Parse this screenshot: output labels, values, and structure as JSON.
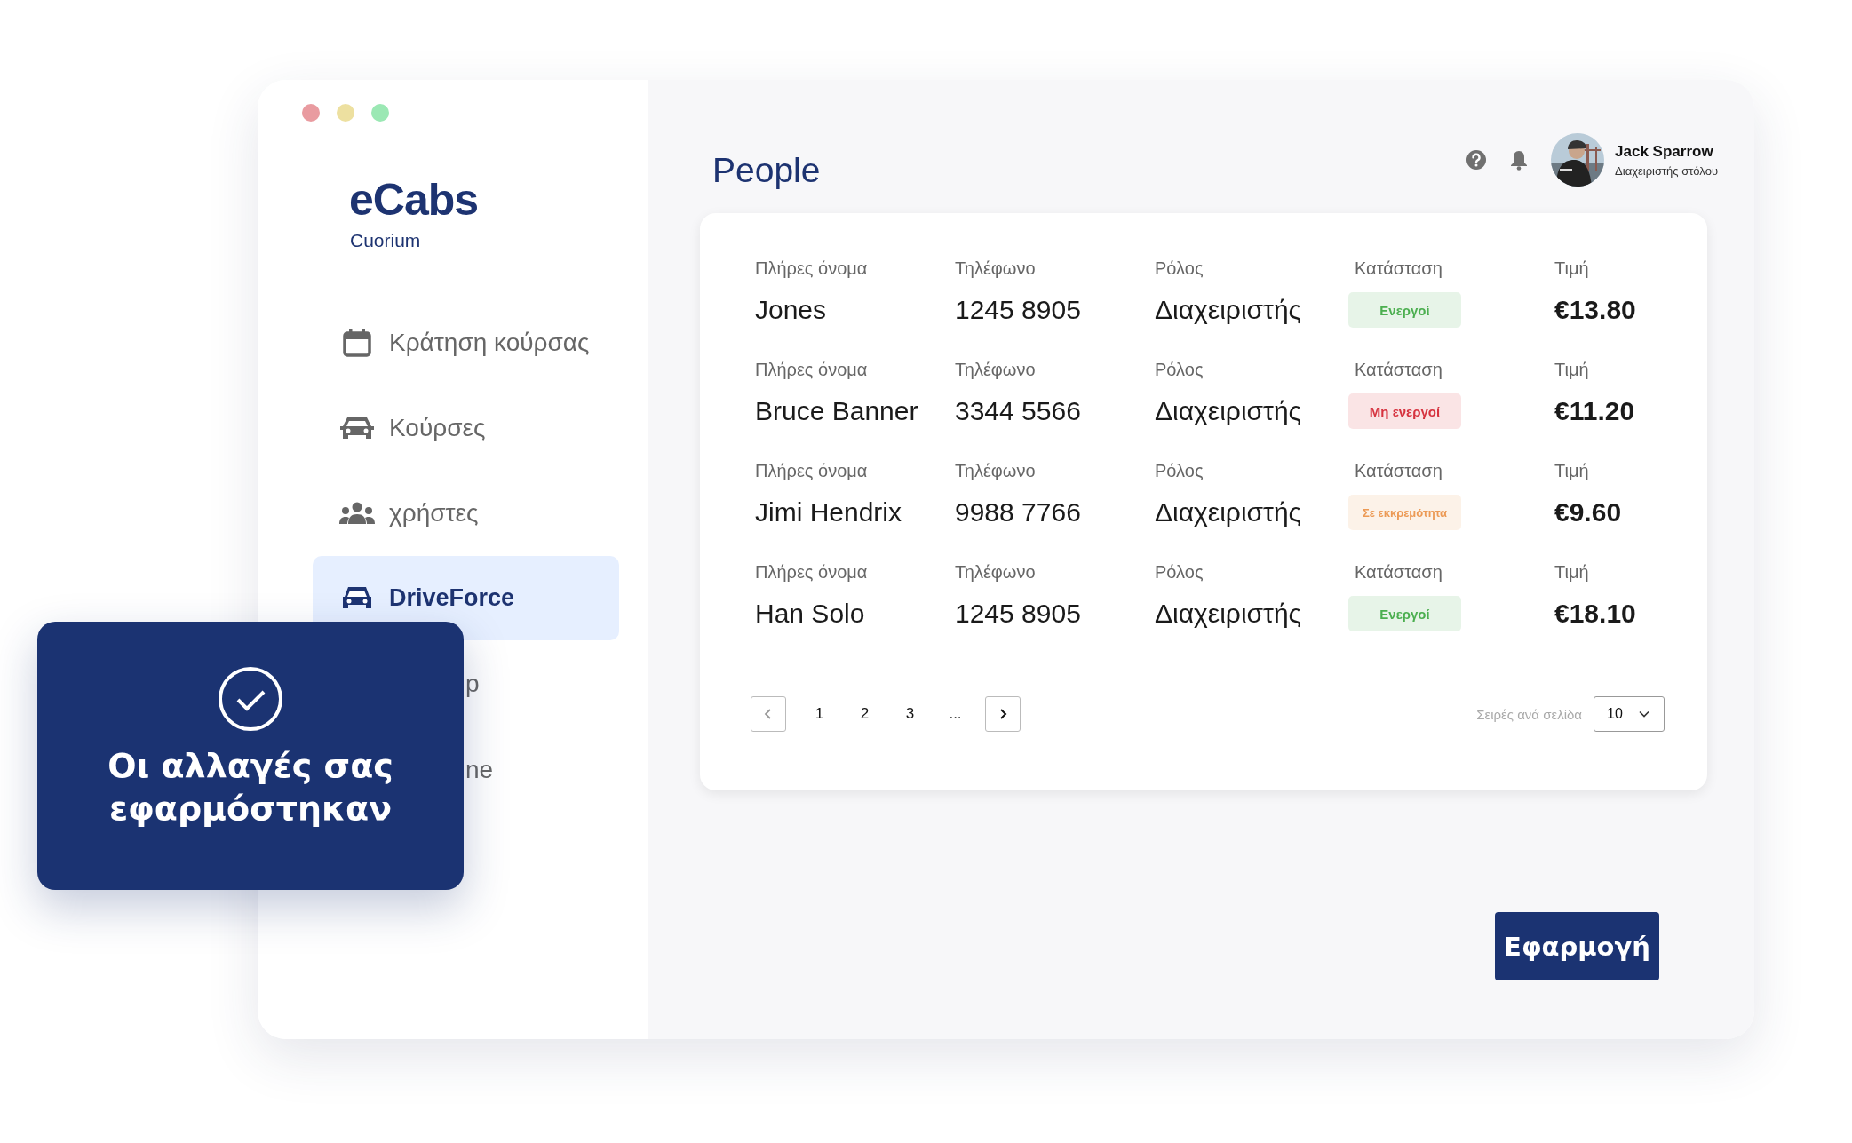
{
  "window": {
    "controls": [
      {
        "color": "#e99ba0"
      },
      {
        "color": "#ede0a0"
      },
      {
        "color": "#9be8b4"
      }
    ]
  },
  "brand": {
    "logo": "eCabs",
    "subtitle": "Cuorium"
  },
  "sidebar": {
    "items": [
      {
        "label": "Κράτηση κούρσας",
        "kind": "full",
        "selected": false
      },
      {
        "label": "Κούρσες",
        "kind": "full",
        "selected": false
      },
      {
        "label": "χρήστες",
        "kind": "full",
        "selected": false
      },
      {
        "label": "DriveForce",
        "kind": "full",
        "selected": true
      },
      {
        "label": "p",
        "kind": "partial",
        "selected": false
      },
      {
        "label": "ne",
        "kind": "partial",
        "selected": false
      }
    ]
  },
  "header": {
    "title": "People",
    "user": {
      "name": "Jack Sparrow",
      "role": "Διαχειριστής στόλου"
    }
  },
  "table": {
    "rows": [
      {
        "fields": [
          {
            "label": "Πλήρες όνομα",
            "value": "Jones",
            "kind": "text"
          },
          {
            "label": "Τηλέφωνο",
            "value": "1245 8905",
            "kind": "text"
          },
          {
            "label": "Ρόλος",
            "value": "Διαχειριστής",
            "kind": "text"
          },
          {
            "label": "Κατάσταση",
            "value": "Ενεργοί",
            "kind": "badge",
            "color": "#4caf50"
          },
          {
            "label": "Τιμή",
            "value": "€13.80",
            "kind": "price"
          }
        ]
      },
      {
        "fields": [
          {
            "label": "Πλήρες όνομα",
            "value": "Bruce Banner",
            "kind": "text"
          },
          {
            "label": "Τηλέφωνο",
            "value": "3344 5566",
            "kind": "text"
          },
          {
            "label": "Ρόλος",
            "value": "Διαχειριστής",
            "kind": "text"
          },
          {
            "label": "Κατάσταση",
            "value": "Μη ενεργοί",
            "kind": "badge",
            "color": "#d6333f"
          },
          {
            "label": "Τιμή",
            "value": "€11.20",
            "kind": "price"
          }
        ]
      },
      {
        "fields": [
          {
            "label": "Πλήρες όνομα",
            "value": "Jimi Hendrix",
            "kind": "text"
          },
          {
            "label": "Τηλέφωνο",
            "value": "9988 7766",
            "kind": "text"
          },
          {
            "label": "Ρόλος",
            "value": "Διαχειριστής",
            "kind": "text"
          },
          {
            "label": "Κατάσταση",
            "value": "Σε εκκρεμότητα",
            "kind": "badge",
            "color": "#ec9a55"
          },
          {
            "label": "Τιμή",
            "value": "€9.60",
            "kind": "price"
          }
        ]
      },
      {
        "fields": [
          {
            "label": "Πλήρες όνομα",
            "value": "Han Solo",
            "kind": "text"
          },
          {
            "label": "Τηλέφωνο",
            "value": "1245 8905",
            "kind": "text"
          },
          {
            "label": "Ρόλος",
            "value": "Διαχειριστής",
            "kind": "text"
          },
          {
            "label": "Κατάσταση",
            "value": "Ενεργοί",
            "kind": "badge",
            "color": "#4caf50"
          },
          {
            "label": "Τιμή",
            "value": "€18.10",
            "kind": "price"
          }
        ]
      }
    ]
  },
  "pagination": {
    "pages": [
      "1",
      "2",
      "3",
      "..."
    ],
    "rows_per_page": {
      "label": "Σειρές ανά σελίδα",
      "value": "10"
    }
  },
  "apply_button": {
    "label": "Εφαρμογή"
  },
  "toast": {
    "message": "Οι αλλαγές σας εφαρμόστηκαν"
  }
}
